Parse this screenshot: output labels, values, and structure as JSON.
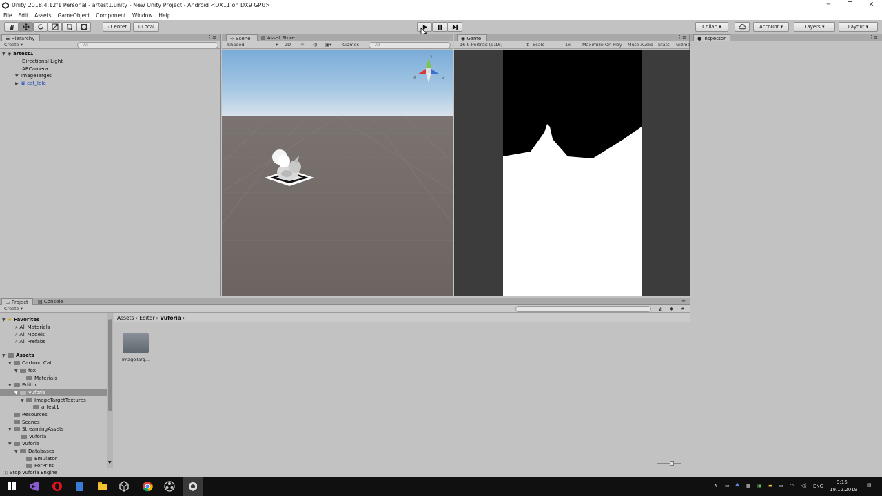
{
  "window": {
    "title": "Unity 2018.4.12f1 Personal - artest1.unity - New Unity Project - Android <DX11 on DX9 GPU>",
    "minimize": "─",
    "maximize": "❐",
    "close": "✕"
  },
  "menu": [
    "File",
    "Edit",
    "Assets",
    "GameObject",
    "Component",
    "Window",
    "Help"
  ],
  "toolbar": {
    "pivot": "Center",
    "space": "Local",
    "collab": "Collab ▾",
    "account": "Account",
    "layers": "Layers",
    "layout": "Layout"
  },
  "hierarchy": {
    "tab": "Hierarchy",
    "create": "Create ▾",
    "search_placeholder": "All",
    "scene": "artest1",
    "items": [
      "Directional Light",
      "ARCamera",
      "ImageTarget",
      "cat_Idle"
    ]
  },
  "scene": {
    "tab_scene": "Scene",
    "tab_asset_store": "Asset Store",
    "shading": "Shaded",
    "mode_2d": "2D",
    "gizmos": "Gizmos",
    "search_placeholder": "All",
    "gizmo_y": "y",
    "gizmo_z": "z",
    "gizmo_x": "x"
  },
  "game": {
    "tab": "Game",
    "aspect": "16:9 Portrait (9:16)",
    "scale_label": "Scale",
    "scale_value": "1x",
    "maximize": "Maximize On Play",
    "mute": "Mute Audio",
    "stats": "Stats",
    "gizmos": "Gizmo"
  },
  "inspector": {
    "tab": "Inspector"
  },
  "project": {
    "tab_project": "Project",
    "tab_console": "Console",
    "create": "Create ▾",
    "favorites": "Favorites",
    "favorite_items": [
      "All Materials",
      "All Models",
      "All Prefabs"
    ],
    "assets_root": "Assets",
    "tree": [
      {
        "label": "Cartoon Cat",
        "depth": 1
      },
      {
        "label": "fox",
        "depth": 2
      },
      {
        "label": "Materials",
        "depth": 3
      },
      {
        "label": "Editor",
        "depth": 1
      },
      {
        "label": "Vuforia",
        "depth": 2
      },
      {
        "label": "ImageTargetTextures",
        "depth": 3
      },
      {
        "label": "artest1",
        "depth": 4
      },
      {
        "label": "Resources",
        "depth": 1
      },
      {
        "label": "Scenes",
        "depth": 1
      },
      {
        "label": "StreamingAssets",
        "depth": 1
      },
      {
        "label": "Vuforia",
        "depth": 2
      },
      {
        "label": "Vuforia",
        "depth": 1
      },
      {
        "label": "Databases",
        "depth": 2
      },
      {
        "label": "Emulator",
        "depth": 3
      },
      {
        "label": "ForPrint",
        "depth": 3
      }
    ],
    "breadcrumb": [
      "Assets",
      "Editor",
      "Vuforia"
    ],
    "files": [
      {
        "name": "ImageTarg..."
      }
    ]
  },
  "status": {
    "text": "Stop Vuforia Engine"
  },
  "taskbar": {
    "lang": "ENG",
    "time": "9:16",
    "date": "19.12.2019"
  }
}
